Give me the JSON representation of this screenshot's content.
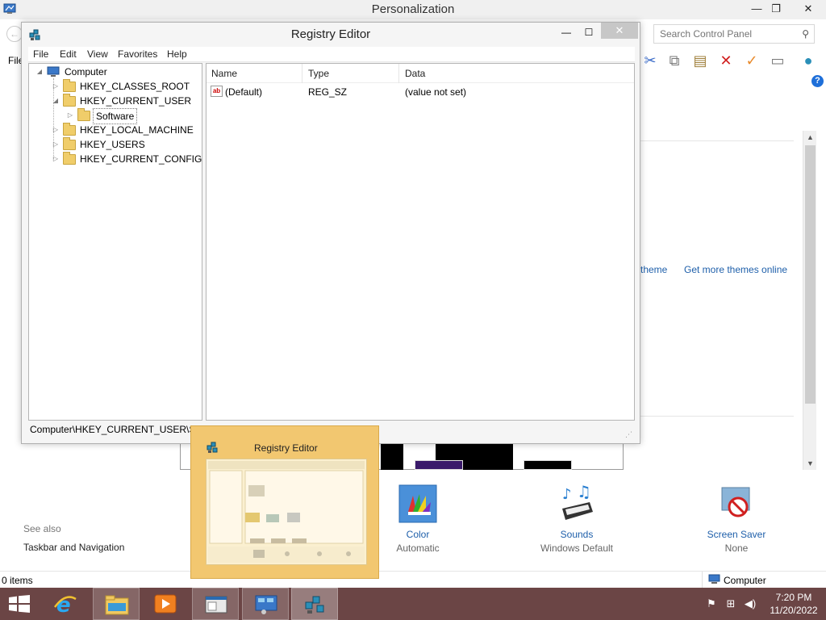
{
  "background_window": {
    "title": "Personalization",
    "controls": {
      "minimize": "—",
      "maximize": "❐",
      "close": "✕"
    },
    "menu_file": "File",
    "search": {
      "placeholder": "Search Control Panel"
    },
    "links": {
      "theme": "theme",
      "more_themes": "Get more themes online"
    },
    "see_also": {
      "heading": "See also",
      "taskbar_navigation": "Taskbar and Navigation"
    },
    "quick_links": [
      {
        "title": "Color",
        "subtitle": "Automatic",
        "icon": "color-palette-icon"
      },
      {
        "title": "Sounds",
        "subtitle": "Windows Default",
        "icon": "sounds-icon"
      },
      {
        "title": "Screen Saver",
        "subtitle": "None",
        "icon": "screen-saver-icon"
      }
    ],
    "status": {
      "items": "0 items",
      "location": "Computer"
    }
  },
  "registry_editor": {
    "title": "Registry Editor",
    "menu": [
      "File",
      "Edit",
      "View",
      "Favorites",
      "Help"
    ],
    "tree": {
      "root": "Computer",
      "nodes": [
        "HKEY_CLASSES_ROOT",
        "HKEY_CURRENT_USER",
        "Software",
        "HKEY_LOCAL_MACHINE",
        "HKEY_USERS",
        "HKEY_CURRENT_CONFIG"
      ]
    },
    "columns": [
      "Name",
      "Type",
      "Data"
    ],
    "values": [
      {
        "name": "(Default)",
        "type": "REG_SZ",
        "data": "(value not set)"
      }
    ],
    "status_path": "Computer\\HKEY_CURRENT_USER\\Software"
  },
  "thumbnail_preview": {
    "title": "Registry Editor"
  },
  "taskbar": {
    "time": "7:20 PM",
    "date": "11/20/2022",
    "colors": {
      "taskbar": "#6b4545",
      "preview": "#f2c770"
    }
  }
}
